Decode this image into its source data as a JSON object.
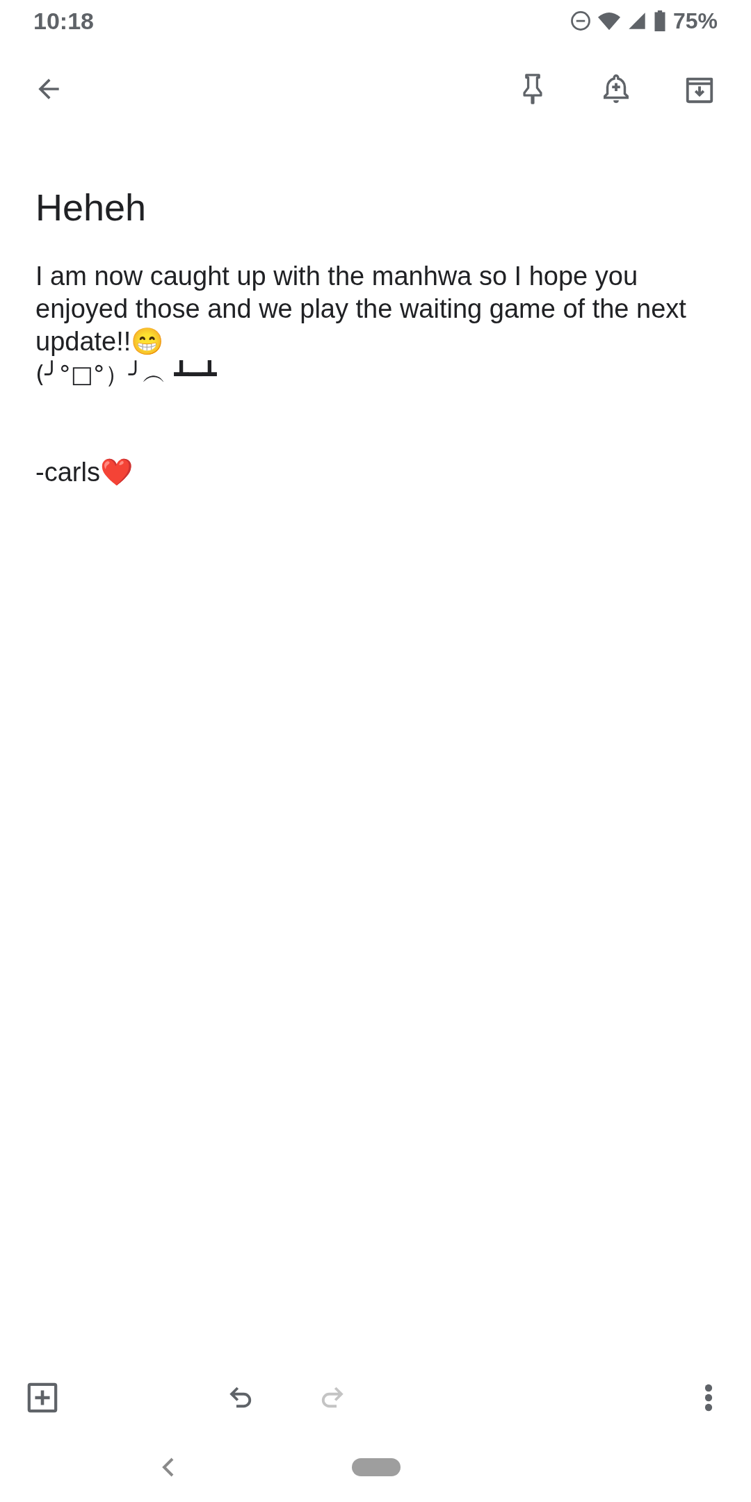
{
  "status_bar": {
    "time": "10:18",
    "battery": "75%"
  },
  "note": {
    "title": "Heheh",
    "body": [
      {
        "text": "I am now caught up with the manhwa so I hope you enjoyed those and we play the waiting game of the next update!!😁"
      },
      {
        "text": "(╯°□°）╯︵ ┻━┻"
      },
      {
        "text": "-carls❤️"
      }
    ]
  },
  "toolbar": {
    "undo_disabled": false,
    "redo_disabled": true
  }
}
